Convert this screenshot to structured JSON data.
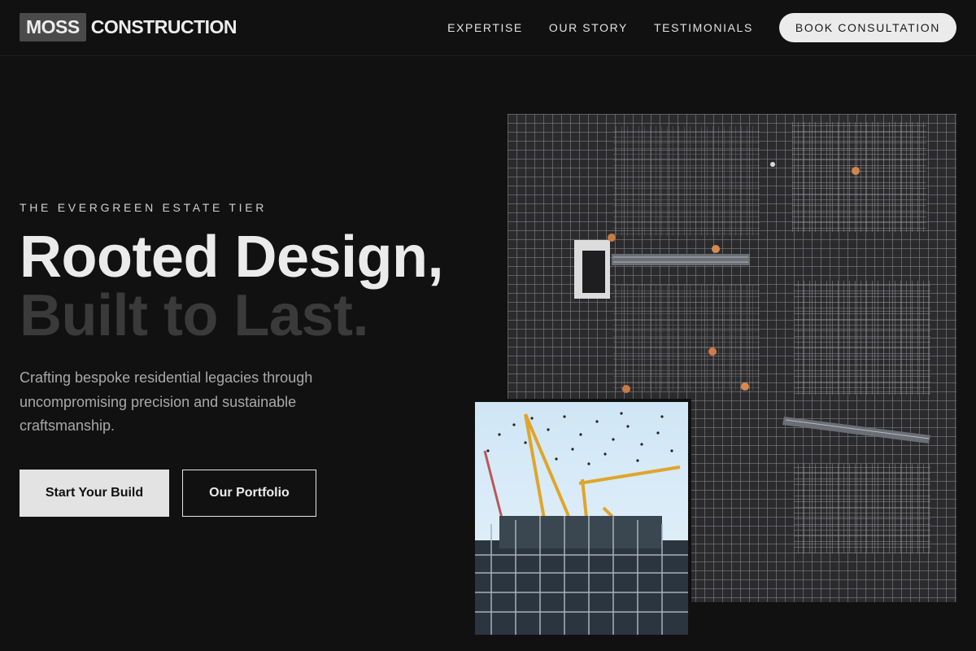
{
  "header": {
    "logo_box": "MOSS",
    "logo_text": "CONSTRUCTION",
    "nav": [
      "EXPERTISE",
      "OUR STORY",
      "TESTIMONIALS"
    ],
    "cta": "BOOK CONSULTATION"
  },
  "hero": {
    "eyebrow": "THE EVERGREEN ESTATE TIER",
    "title_line1": "Rooted Design,",
    "title_line2": "Built to Last.",
    "description": "Crafting bespoke residential legacies through uncompromising precision and sustainable craftsmanship.",
    "primary_button": "Start Your Build",
    "secondary_button": "Our Portfolio"
  },
  "images": {
    "main": "aerial-rebar-grid-workers",
    "secondary": "tower-cranes-scaffolding-birds"
  },
  "colors": {
    "background": "#111111",
    "accent_light": "#e3e3e3",
    "muted_title": "#3a3a3a"
  }
}
